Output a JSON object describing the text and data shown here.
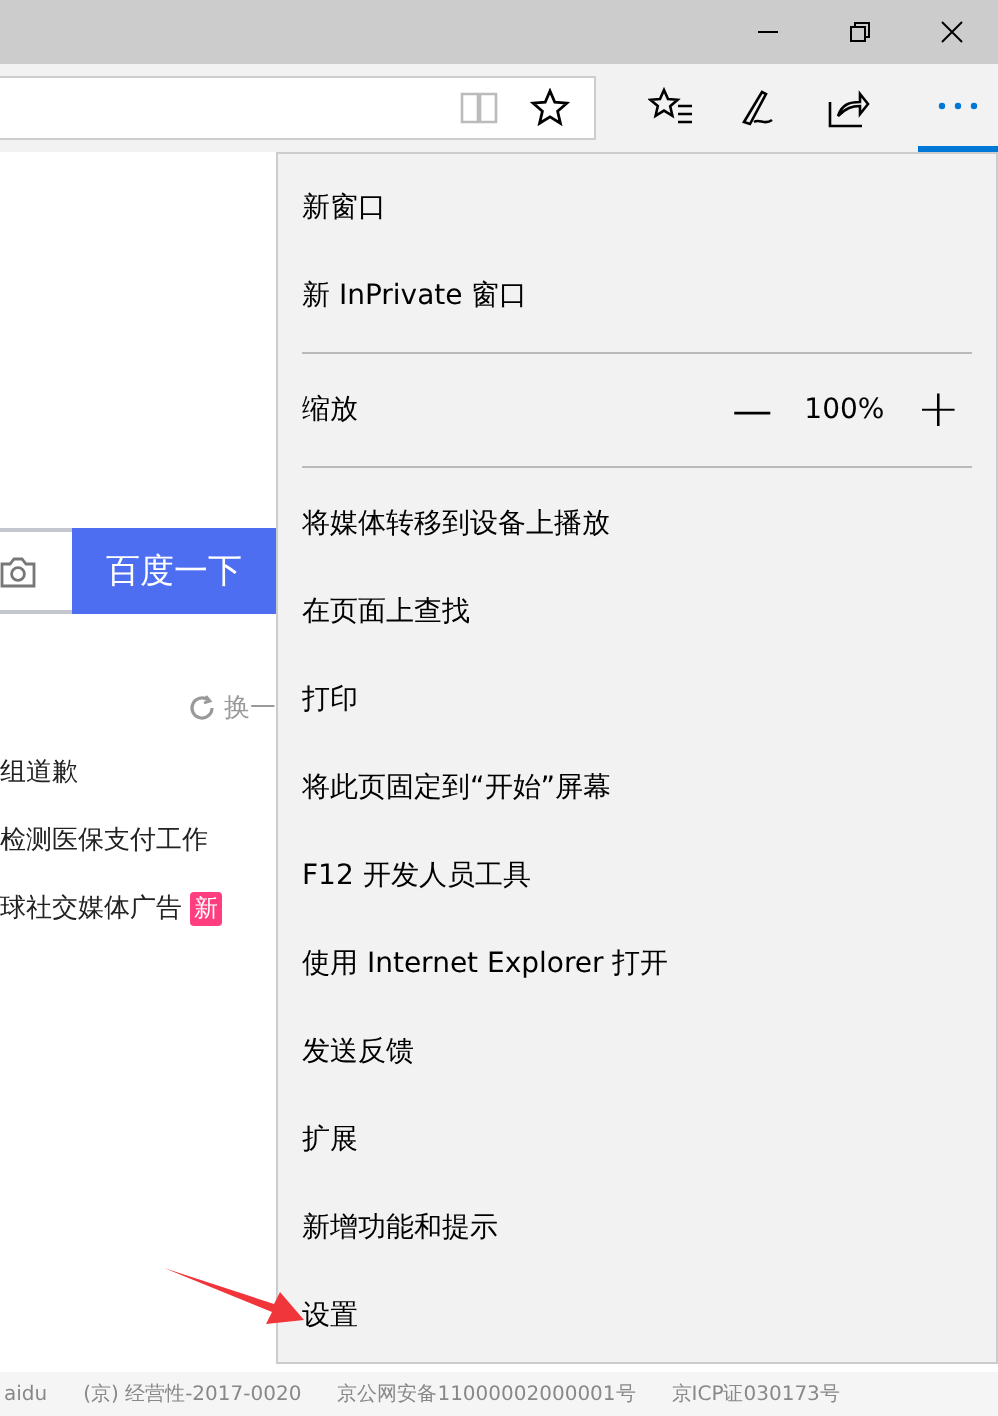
{
  "search": {
    "button": "百度一下"
  },
  "refresh_link": "换一",
  "hot_list": [
    {
      "text": "组道歉"
    },
    {
      "text": "检测医保支付工作"
    },
    {
      "text": "球社交媒体广告",
      "badge": "新"
    }
  ],
  "menu": {
    "items": [
      {
        "kind": "item",
        "label": "新窗口"
      },
      {
        "kind": "item",
        "label": "新 InPrivate 窗口"
      },
      {
        "kind": "divider"
      },
      {
        "kind": "zoom",
        "label": "缩放",
        "value": "100%",
        "minus": "—",
        "plus": "+"
      },
      {
        "kind": "divider"
      },
      {
        "kind": "item",
        "label": "将媒体转移到设备上播放"
      },
      {
        "kind": "item",
        "label": "在页面上查找"
      },
      {
        "kind": "item",
        "label": "打印"
      },
      {
        "kind": "item",
        "label": "将此页固定到“开始”屏幕"
      },
      {
        "kind": "item",
        "label": "F12 开发人员工具"
      },
      {
        "kind": "item",
        "label": "使用 Internet Explorer 打开"
      },
      {
        "kind": "item",
        "label": "发送反馈"
      },
      {
        "kind": "item",
        "label": "扩展"
      },
      {
        "kind": "item",
        "label": "新增功能和提示"
      },
      {
        "kind": "item",
        "label": "设置"
      }
    ]
  },
  "footer": [
    "aidu",
    "(京) 经营性-2017-0020",
    "京公网安备11000002000001号",
    "京ICP证030173号"
  ]
}
